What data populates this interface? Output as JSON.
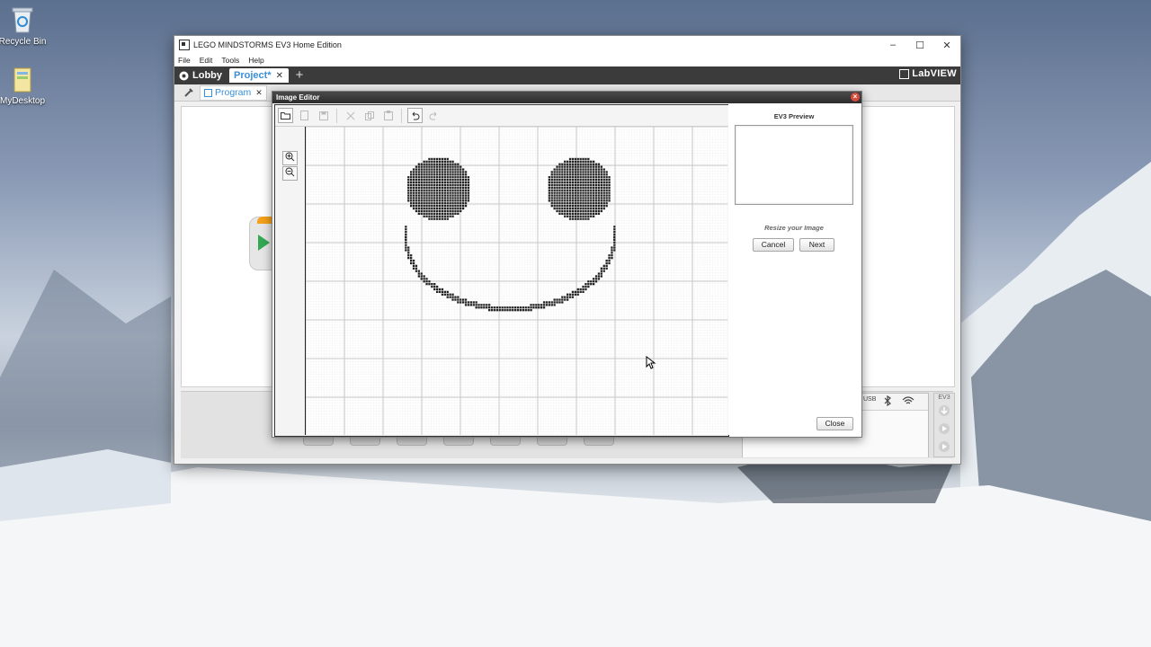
{
  "desktop": {
    "icons": [
      {
        "label": "Recycle Bin",
        "icon": "recycle-bin-icon"
      },
      {
        "label": "MyDesktop",
        "icon": "folder-icon"
      }
    ]
  },
  "window": {
    "title": "LEGO MINDSTORMS EV3 Home Edition",
    "controls": {
      "minimize": "–",
      "maximize": "☐",
      "close": "✕"
    }
  },
  "menu": [
    "File",
    "Edit",
    "Tools",
    "Help"
  ],
  "tabs": {
    "lobby": "Lobby",
    "project": "Project*",
    "close": "✕",
    "add": "+"
  },
  "brand": "LabVIEW",
  "program_tab": {
    "label": "Program",
    "close": "✕"
  },
  "image_editor": {
    "title": "Image Editor",
    "close": "×",
    "toolbar": [
      "open-icon",
      "new-icon",
      "save-icon",
      "cut-icon",
      "copy-icon",
      "paste-icon",
      "undo-icon",
      "redo-icon"
    ],
    "zoom": {
      "in": "+",
      "out": "−"
    },
    "drawing": {
      "eyes": "filled-circles",
      "mouth": "smile-arc",
      "pixel_color": "#222222"
    },
    "side_panel": {
      "preview_title": "EV3 Preview",
      "resize_label": "Resize your Image",
      "cancel": "Cancel",
      "next": "Next",
      "close": "Close"
    }
  },
  "hardware_panel": {
    "usb": "USB",
    "bluetooth": "bluetooth-icon",
    "wifi": "wifi-icon",
    "ev3": "EV3"
  },
  "colors": {
    "tab_accent": "#3a8fd6",
    "tabbar_bg": "#3b3b3b",
    "start_orange": "#f3a01a",
    "start_green": "#34a853"
  }
}
